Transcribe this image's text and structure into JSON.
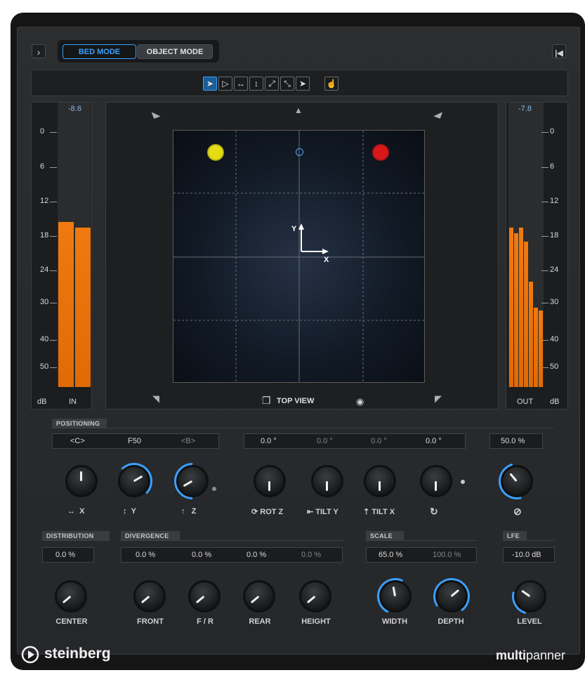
{
  "header": {
    "expand_icon": "chevron-right-icon",
    "bed_mode_label": "BED MODE",
    "object_mode_label": "OBJECT MODE",
    "skip_icon": "skip-start-icon",
    "accent": "#3aa0ff"
  },
  "toolbar": {
    "tools": [
      {
        "name": "select-tool",
        "icon": "pointer-icon",
        "glyph": "➤",
        "active": true
      },
      {
        "name": "outline-select-tool",
        "icon": "pointer-outline-icon",
        "glyph": "▷",
        "active": false
      },
      {
        "name": "move-x-tool",
        "icon": "horizontal-arrows-icon",
        "glyph": "↔",
        "active": false
      },
      {
        "name": "move-y-tool",
        "icon": "vertical-arrows-icon",
        "glyph": "↕",
        "active": false
      },
      {
        "name": "diag-up-tool",
        "icon": "diagonal-ne-icon",
        "glyph": "⤢",
        "active": false
      },
      {
        "name": "diag-down-tool",
        "icon": "diagonal-se-icon",
        "glyph": "⤡",
        "active": false
      },
      {
        "name": "pointer-z-tool",
        "icon": "pointer-dot-icon",
        "glyph": "➤",
        "active": false
      },
      {
        "name": "link-tool",
        "icon": "touch-icon",
        "glyph": "☝",
        "active": false
      }
    ]
  },
  "input_meter": {
    "peak": "-8.6",
    "scale": [
      "0",
      "6",
      "12",
      "18",
      "24",
      "30",
      "40",
      "50"
    ],
    "left_label": "dB",
    "right_label": "IN",
    "levels": [
      0.58,
      0.56
    ]
  },
  "output_meter": {
    "peak": "-7.8",
    "scale": [
      "0",
      "6",
      "12",
      "18",
      "24",
      "30",
      "40",
      "50"
    ],
    "left_label": "OUT",
    "right_label": "dB",
    "levels": [
      0.56,
      0.54,
      0.56,
      0.51,
      0.37,
      0.28,
      0.27
    ]
  },
  "stage": {
    "view_label": "TOP VIEW",
    "view_icon": "cube-icon",
    "eye_icon": "eye-icon",
    "axis_x": "X",
    "axis_y": "Y",
    "sources": [
      {
        "color": "#e6dc14"
      },
      {
        "color": "#d81818"
      }
    ]
  },
  "positioning": {
    "label": "POSITIONING",
    "left_values": [
      "<C>",
      "F50",
      "<B>"
    ],
    "angle_values": [
      "0.0 °",
      "0.0 °",
      "0.0 °",
      "0.0 °"
    ],
    "percent_value": "50.0 %",
    "knobs": [
      {
        "name": "x-knob",
        "label": "X",
        "icon": "horizontal-arrows-icon",
        "glyph": "↔"
      },
      {
        "name": "y-knob",
        "label": "Y",
        "icon": "vertical-arrows-icon",
        "glyph": "↕"
      },
      {
        "name": "z-knob",
        "label": "Z",
        "icon": "up-arrow-icon",
        "glyph": "↑"
      },
      {
        "name": "rot-z-knob",
        "label": "ROT Z",
        "icon": "rotate-icon",
        "glyph": "⟳"
      },
      {
        "name": "tilt-y-knob",
        "label": "TILT Y",
        "icon": "tilt-y-icon",
        "glyph": "⇤"
      },
      {
        "name": "tilt-x-knob",
        "label": "TILT X",
        "icon": "tilt-x-icon",
        "glyph": "⇡"
      },
      {
        "name": "roll-knob",
        "label": "",
        "icon": "rotate-cw-icon",
        "glyph": "↻"
      },
      {
        "name": "size-knob",
        "label": "",
        "icon": "circle-slash-icon",
        "glyph": "⊘"
      }
    ]
  },
  "distribution": {
    "label": "DISTRIBUTION",
    "value": "0.0 %",
    "knob_label": "CENTER"
  },
  "divergence": {
    "label": "DIVERGENCE",
    "values": [
      "0.0 %",
      "0.0 %",
      "0.0 %",
      "0.0 %"
    ],
    "knob_labels": [
      "FRONT",
      "F / R",
      "REAR",
      "HEIGHT"
    ]
  },
  "scale": {
    "label": "SCALE",
    "values": [
      "65.0 %",
      "100.0 %"
    ],
    "knob_labels": [
      "WIDTH",
      "DEPTH"
    ]
  },
  "lfe": {
    "label": "LFE",
    "value": "-10.0 dB",
    "knob_label": "LEVEL"
  },
  "footer": {
    "brand": "steinberg",
    "product_bold": "multi",
    "product_light": "panner",
    "brand_icon": "steinberg-logo-icon"
  }
}
